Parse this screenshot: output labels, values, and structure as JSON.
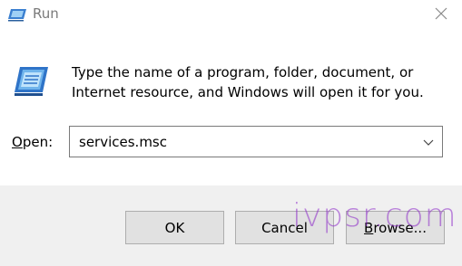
{
  "window": {
    "title": "Run",
    "icon": "run-icon",
    "close_icon": "close-icon"
  },
  "dialog": {
    "icon": "run-app-icon",
    "description": "Type the name of a program, folder, document, or Internet resource, and Windows will open it for you.",
    "open_label_accel": "O",
    "open_label_rest": "pen:",
    "input_value": "services.msc",
    "dropdown_icon": "chevron-down-icon"
  },
  "buttons": {
    "ok": "OK",
    "cancel": "Cancel",
    "browse_accel": "B",
    "browse_rest": "rowse..."
  },
  "watermark": "ivpsr.com",
  "colors": {
    "footer_bg": "#f0f0f0",
    "button_bg": "#e1e1e1",
    "button_border": "#adadad",
    "title_text": "#7a7a7a",
    "watermark": "#8c28c8"
  }
}
